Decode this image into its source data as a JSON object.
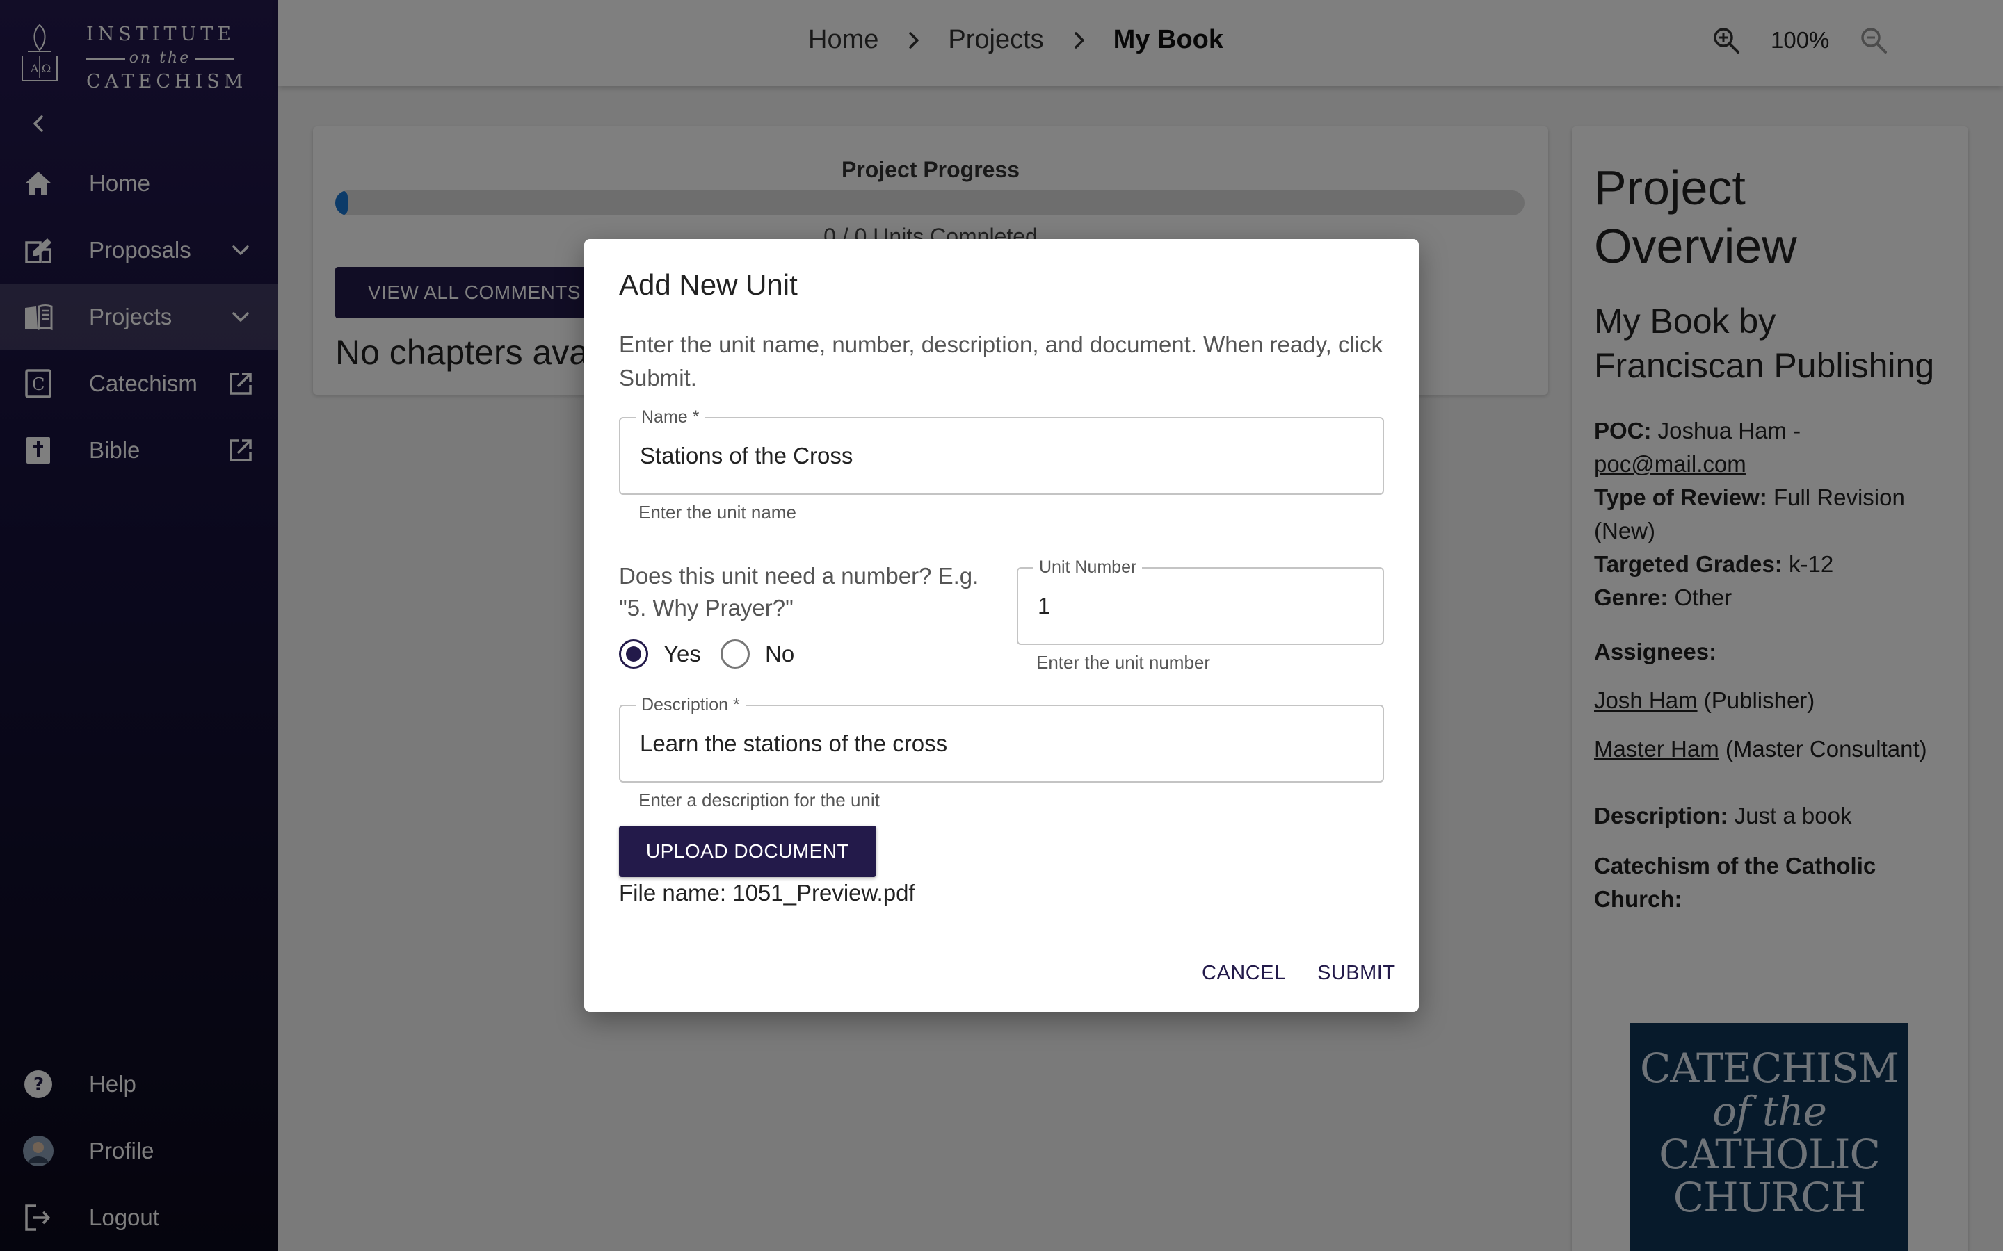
{
  "app": {
    "logo": {
      "line1": "INSTITUTE",
      "line2": "on the",
      "line3": "CATECHISM"
    }
  },
  "sidebar": {
    "items": [
      {
        "label": "Home",
        "icon": "home-icon"
      },
      {
        "label": "Proposals",
        "icon": "proposals-icon",
        "trailing": "chevron-down-icon"
      },
      {
        "label": "Projects",
        "icon": "book-open-icon",
        "trailing": "chevron-down-icon",
        "active": true
      },
      {
        "label": "Catechism",
        "icon": "catechism-icon",
        "trailing": "external-link-icon"
      },
      {
        "label": "Bible",
        "icon": "bible-icon",
        "trailing": "external-link-icon"
      }
    ],
    "bottom_items": [
      {
        "label": "Help",
        "icon": "help-icon"
      },
      {
        "label": "Profile",
        "icon": "avatar"
      },
      {
        "label": "Logout",
        "icon": "logout-icon"
      }
    ]
  },
  "header": {
    "breadcrumb": [
      "Home",
      "Projects",
      "My Book"
    ],
    "zoom": "100%"
  },
  "progress": {
    "title": "Project Progress",
    "caption": "0 / 0 Units Completed",
    "percent": 0,
    "view_comments": "VIEW ALL COMMENTS",
    "empty_text": "No chapters available"
  },
  "overview": {
    "title": "Project Overview",
    "subtitle": "My Book by Franciscan Publishing",
    "poc_label": "POC:",
    "poc_name": "Joshua Ham -",
    "poc_email": "poc@mail.com",
    "review_label": "Type of Review:",
    "review_value": "Full Revision (New)",
    "grades_label": "Targeted Grades:",
    "grades_value": "k-12",
    "genre_label": "Genre:",
    "genre_value": "Other",
    "assignees_label": "Assignees:",
    "assignees": [
      {
        "name": "Josh Ham",
        "role": "(Publisher)"
      },
      {
        "name": "Master Ham",
        "role": "(Master Consultant)"
      }
    ],
    "description_label": "Description:",
    "description_value": "Just a book",
    "catechism_label": "Catechism of the Catholic Church:",
    "cover": {
      "line1": "CATECHISM",
      "line2": "of the",
      "line3": "CATHOLIC",
      "line4": "CHURCH"
    }
  },
  "dialog": {
    "title": "Add New Unit",
    "instructions": "Enter the unit name, number, description, and document. When ready, click Submit.",
    "name_label": "Name *",
    "name_value": "Stations of the Cross",
    "name_helper": "Enter the unit name",
    "number_question": "Does this unit need a number? E.g. \"5. Why Prayer?\"",
    "radio_yes": "Yes",
    "radio_no": "No",
    "selected": "Yes",
    "unit_number_label": "Unit Number",
    "unit_number_value": "1",
    "unit_number_helper": "Enter the unit number",
    "description_label": "Description *",
    "description_value": "Learn the stations of the cross",
    "description_helper": "Enter a description for the unit",
    "upload_label": "UPLOAD DOCUMENT",
    "file_name": "File name: 1051_Preview.pdf",
    "cancel": "CANCEL",
    "submit": "SUBMIT"
  },
  "colors": {
    "primary": "#231a4a",
    "sidebar_top": "#241a4f",
    "sidebar_bottom": "#0b0a1c",
    "progress_fill": "#1976d2",
    "book_cover": "#0f3456"
  }
}
